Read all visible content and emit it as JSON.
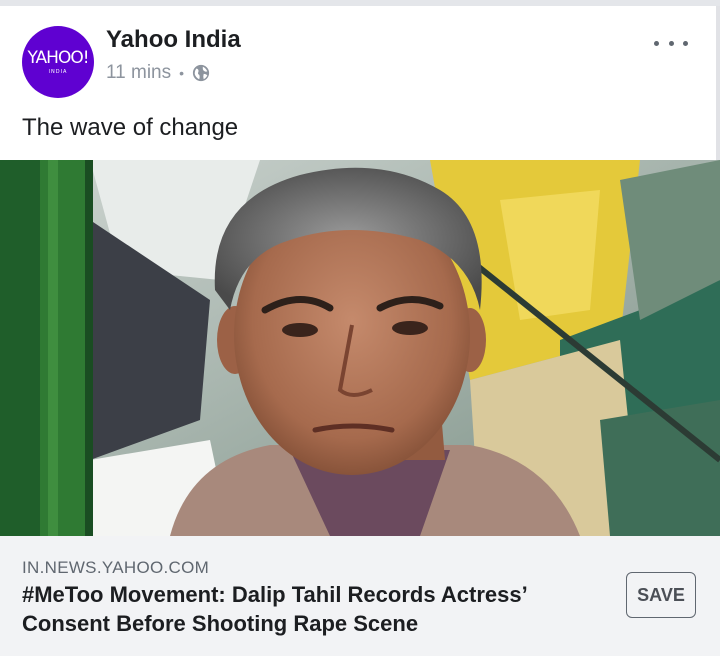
{
  "post": {
    "page_name": "Yahoo India",
    "avatar": {
      "logo_text": "YAHOO!",
      "logo_subtext": "INDIA",
      "color": "#5f01d1"
    },
    "timestamp": "11 mins",
    "separator": "•",
    "privacy_icon": "globe-icon",
    "menu_icon": "more-horizontal-icon",
    "text": "The wave of change"
  },
  "link_preview": {
    "domain": "IN.NEWS.YAHOO.COM",
    "title": "#MeToo Movement: Dalip Tahil Records Actress’ Consent Before Shooting Rape Scene",
    "save_label": "SAVE"
  }
}
